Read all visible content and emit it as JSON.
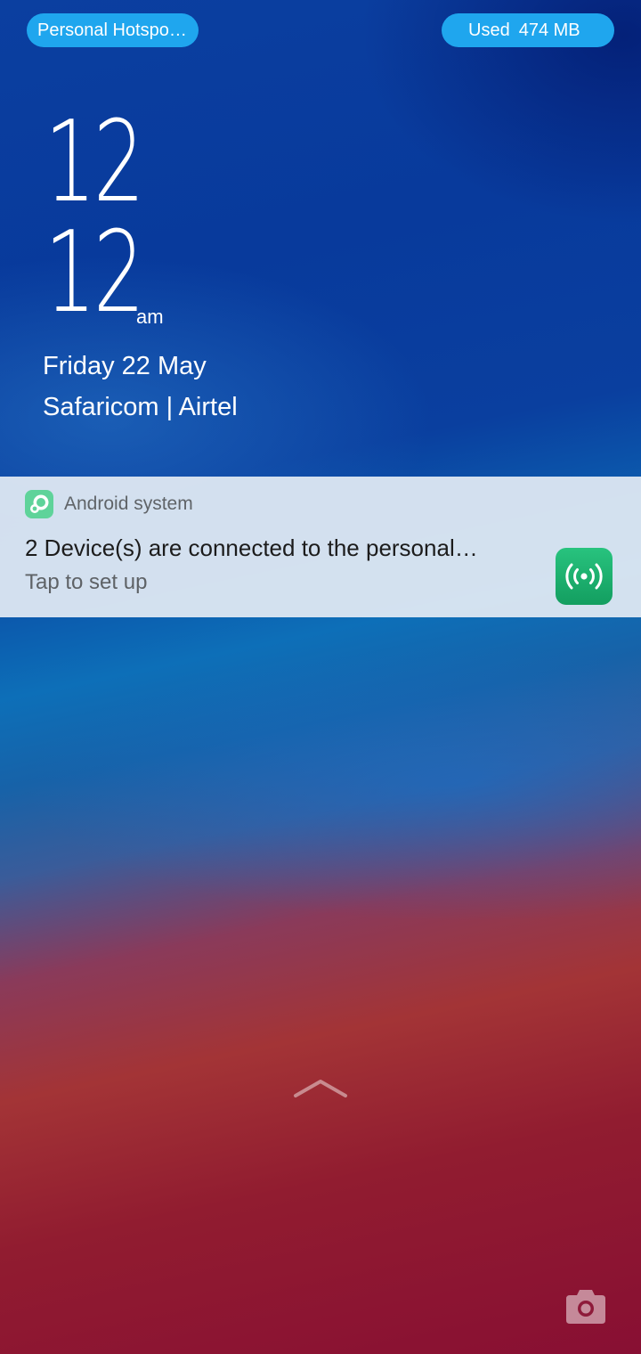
{
  "status_pills": {
    "hotspot_label": "Personal Hotspo…",
    "data_used_label": "Used",
    "data_used_value": "474 MB"
  },
  "lockscreen": {
    "hour": "12",
    "minute": "12",
    "ampm": "am",
    "date": "Friday 22 May",
    "carriers": "Safaricom | Airtel"
  },
  "notification": {
    "app_name": "Android system",
    "app_icon": "android-system-icon",
    "title": "2 Device(s) are connected to the personal…",
    "subtitle": "Tap to set up",
    "action_icon": "hotspot-icon",
    "action_color": "#1fb46f"
  },
  "bottom": {
    "unlock_icon": "chevron-up-icon",
    "camera_icon": "camera-icon"
  },
  "colors": {
    "pill_bg": "#1fa6ee",
    "notification_bg": "#dee8f2",
    "wallpaper_top": "#0b3fa0",
    "wallpaper_bottom": "#880f33"
  }
}
